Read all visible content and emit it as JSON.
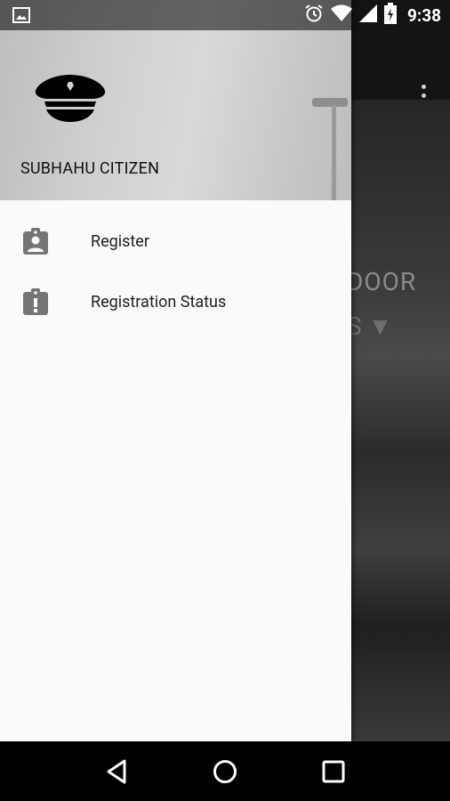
{
  "status_bar": {
    "time": "9:38",
    "icons": [
      "gallery-icon",
      "alarm-icon",
      "wifi-icon",
      "signal-icon",
      "battery-charging-icon"
    ]
  },
  "app_background": {
    "hero_line_1": "DOOR",
    "hero_line_2": "S ▼"
  },
  "drawer": {
    "header": {
      "logo_icon": "police-cap-icon",
      "user_name": "SUBHAHU CITIZEN"
    },
    "items": [
      {
        "label": "Register",
        "icon": "assignment-ind-icon"
      },
      {
        "label": "Registration Status",
        "icon": "assignment-late-icon"
      }
    ]
  },
  "nav_bar": {
    "buttons": [
      "back-icon",
      "home-icon",
      "recents-icon"
    ]
  },
  "colors": {
    "drawer_bg": "#fafafa",
    "header_bg": "#cfcfcf",
    "icon_gray": "#757575",
    "text_primary": "#212121"
  }
}
